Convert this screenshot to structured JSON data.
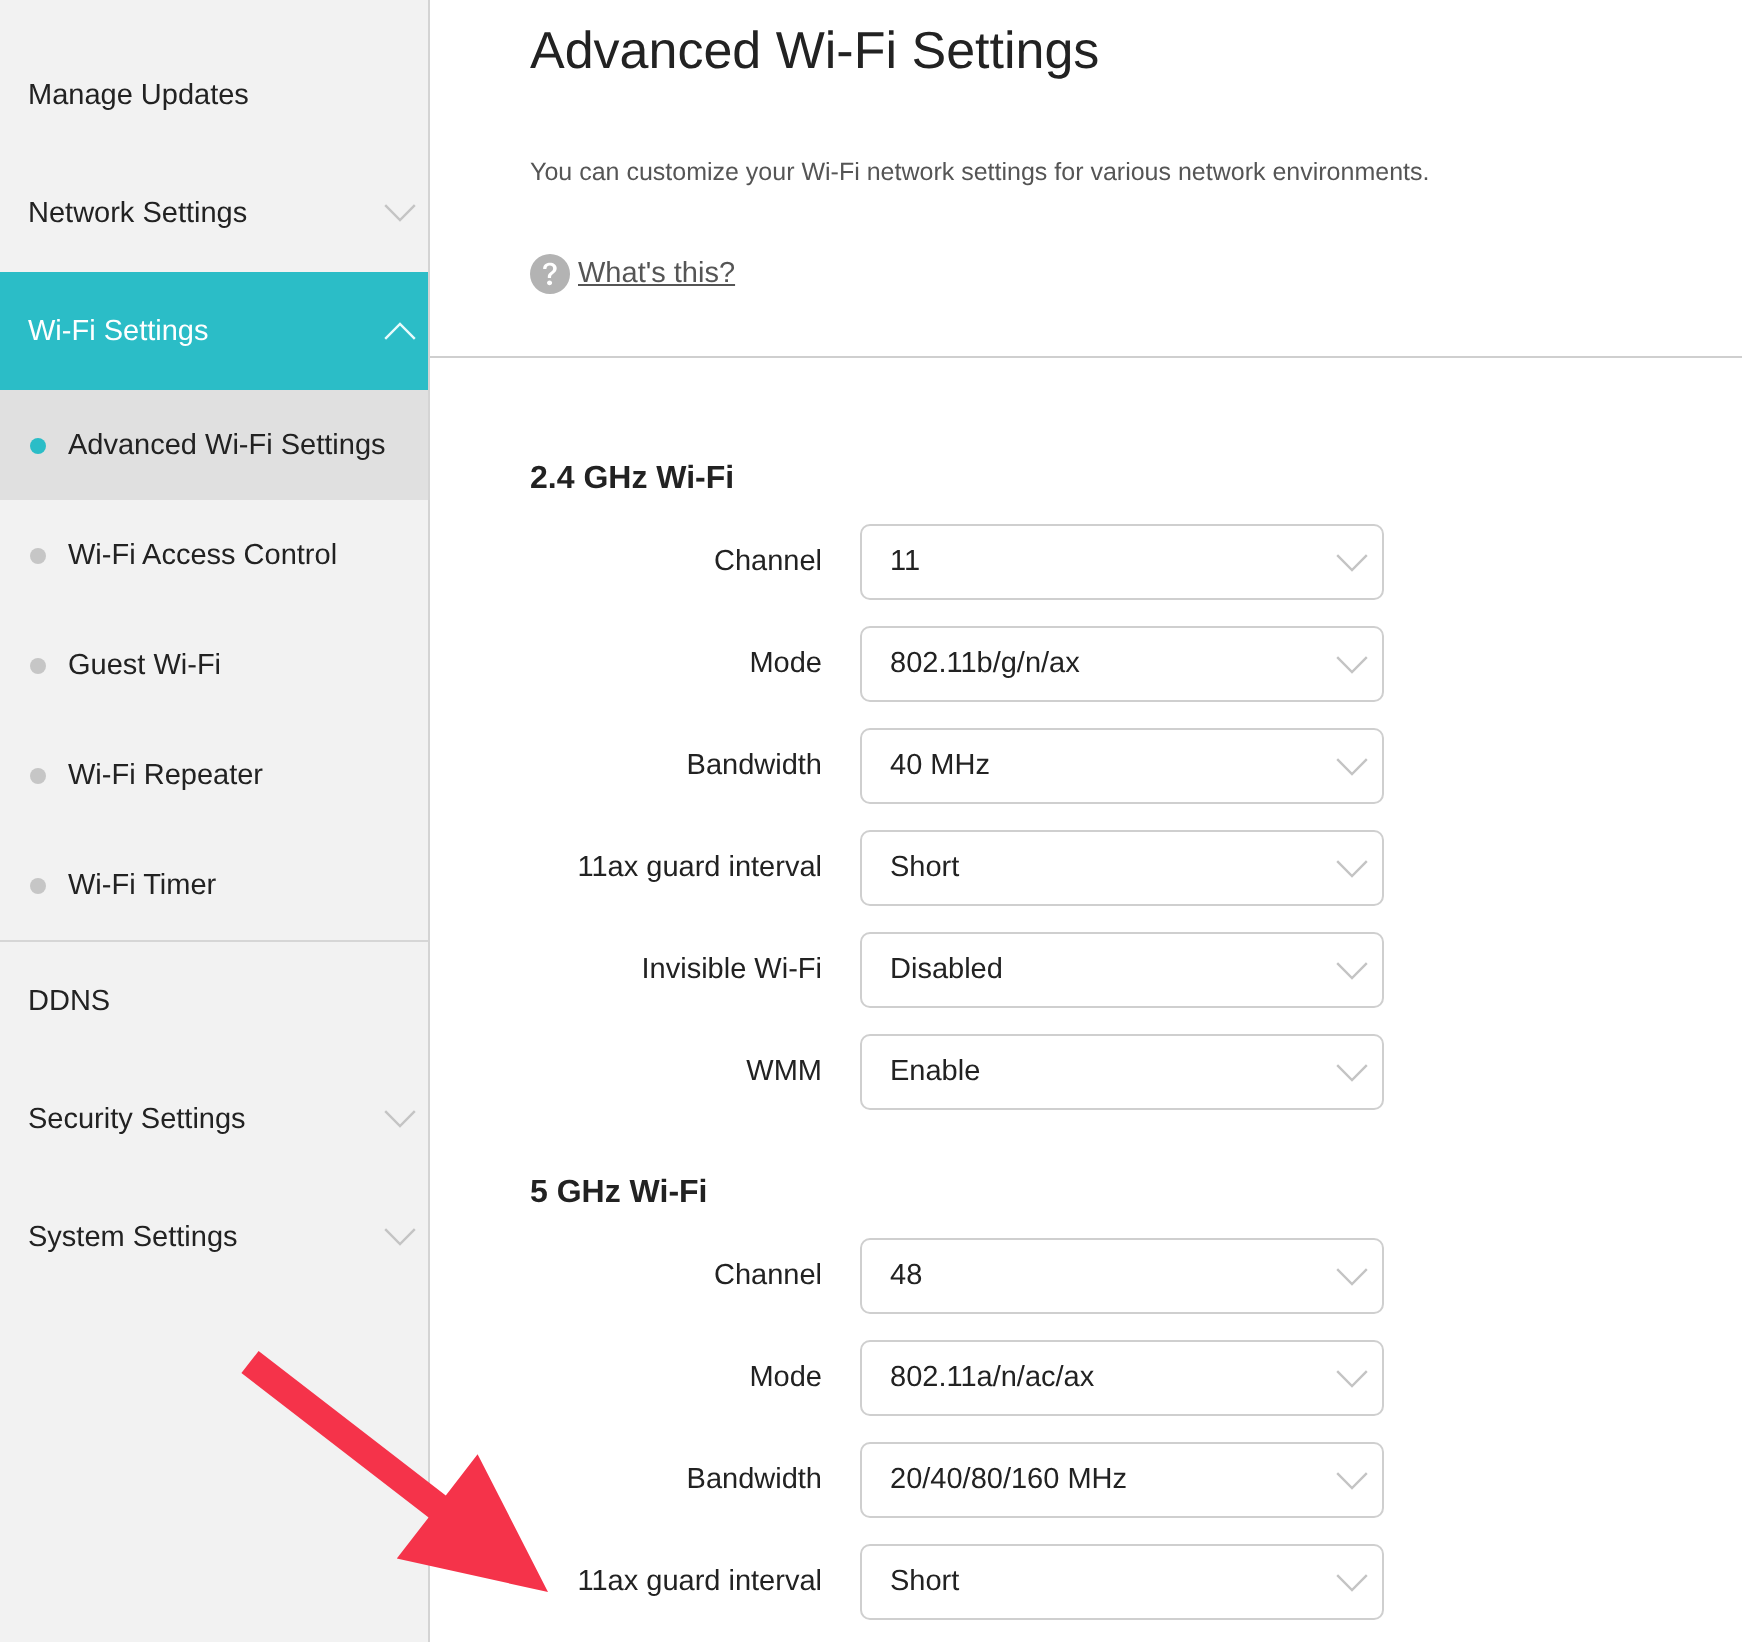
{
  "sidebar": {
    "items": [
      {
        "label": "Manage Updates",
        "kind": "link",
        "selected": false
      },
      {
        "label": "Network Settings",
        "kind": "group",
        "selected": false,
        "expanded": false
      },
      {
        "label": "Wi-Fi Settings",
        "kind": "group",
        "selected": true,
        "expanded": true,
        "children": [
          {
            "label": "Advanced Wi-Fi Settings",
            "selected": true
          },
          {
            "label": "Wi-Fi Access Control",
            "selected": false
          },
          {
            "label": "Guest Wi-Fi",
            "selected": false
          },
          {
            "label": "Wi-Fi Repeater",
            "selected": false
          },
          {
            "label": "Wi-Fi Timer",
            "selected": false
          }
        ]
      },
      {
        "label": "DDNS",
        "kind": "link",
        "selected": false
      },
      {
        "label": "Security Settings",
        "kind": "group",
        "selected": false,
        "expanded": false
      },
      {
        "label": "System Settings",
        "kind": "group",
        "selected": false,
        "expanded": false
      }
    ]
  },
  "page": {
    "title": "Advanced Wi-Fi Settings",
    "description": "You can customize your Wi-Fi network settings for various network environments.",
    "help_link": "What's this?"
  },
  "sections": [
    {
      "title": "2.4 GHz Wi-Fi",
      "fields": [
        {
          "label": "Channel",
          "value": "11"
        },
        {
          "label": "Mode",
          "value": "802.11b/g/n/ax"
        },
        {
          "label": "Bandwidth",
          "value": "40 MHz"
        },
        {
          "label": "11ax guard interval",
          "value": "Short"
        },
        {
          "label": "Invisible Wi-Fi",
          "value": "Disabled"
        },
        {
          "label": "WMM",
          "value": "Enable"
        }
      ]
    },
    {
      "title": "5 GHz Wi-Fi",
      "fields": [
        {
          "label": "Channel",
          "value": "48"
        },
        {
          "label": "Mode",
          "value": "802.11a/n/ac/ax"
        },
        {
          "label": "Bandwidth",
          "value": "20/40/80/160 MHz"
        },
        {
          "label": "11ax guard interval",
          "value": "Short"
        }
      ]
    }
  ]
}
